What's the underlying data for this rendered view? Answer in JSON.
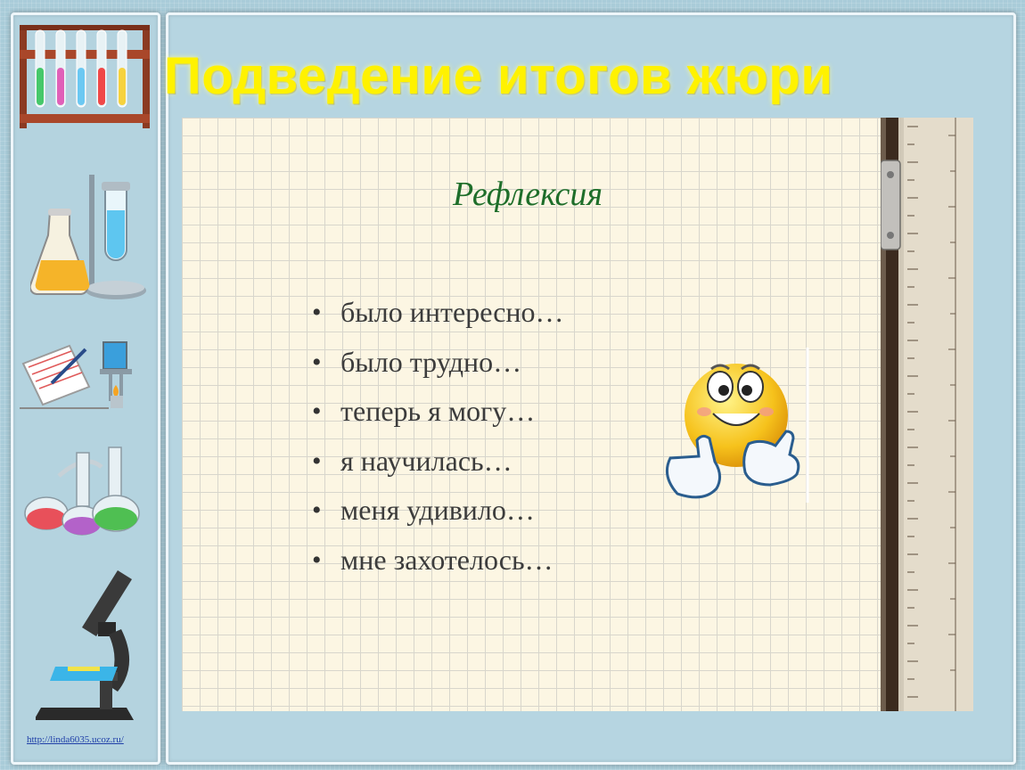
{
  "slide": {
    "title": "Подведение итогов жюри",
    "subtitle": "Рефлексия",
    "bullets": [
      "было интересно…",
      "было трудно…",
      "теперь я могу…",
      "я научилась…",
      "меня удивило…",
      "мне захотелось…"
    ],
    "bullet_glyph": "•"
  },
  "footer": {
    "url_text": "http://linda6035.ucoz.ru/"
  },
  "icons": {
    "sidebar": [
      "test-tube-rack-icon",
      "flask-stand-icon",
      "notebook-burner-icon",
      "retort-flasks-icon",
      "microscope-icon"
    ],
    "content": [
      "smiley-thumbs-up-icon",
      "ruler-icon"
    ]
  },
  "colors": {
    "title": "#fff200",
    "subtitle": "#1e6e2a",
    "bullet_text": "#3c3c3c",
    "paper": "#fcf6e3",
    "background": "#a9ccd9"
  }
}
